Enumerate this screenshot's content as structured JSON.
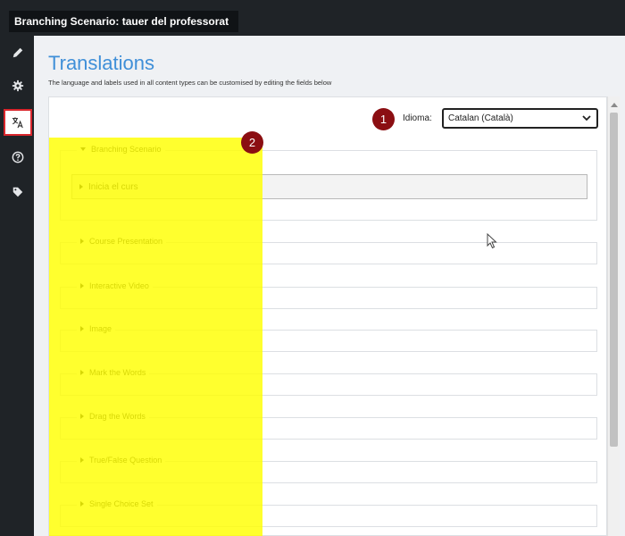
{
  "window": {
    "title": "Branching Scenario: tauer del professorat"
  },
  "sidebar": {
    "items": [
      {
        "icon": "pencil-icon",
        "active": false
      },
      {
        "icon": "gear-icon",
        "active": false
      },
      {
        "icon": "translate-icon",
        "active": true
      },
      {
        "icon": "help-icon",
        "active": false
      },
      {
        "icon": "tag-icon",
        "active": false
      }
    ]
  },
  "page": {
    "title": "Translations",
    "description": "The language and labels used in all content types can be customised by editing the fields below"
  },
  "language": {
    "label": "Idioma:",
    "selected": "Catalan (Català)"
  },
  "annotations": [
    "1",
    "2"
  ],
  "groups": [
    {
      "label": "Branching Scenario",
      "expanded": true,
      "subgroup": "Inicia el curs"
    },
    {
      "label": "Course Presentation",
      "expanded": false
    },
    {
      "label": "Interactive Video",
      "expanded": false
    },
    {
      "label": "Image",
      "expanded": false
    },
    {
      "label": "Mark the Words",
      "expanded": false
    },
    {
      "label": "Drag the Words",
      "expanded": false
    },
    {
      "label": "True/False Question",
      "expanded": false
    },
    {
      "label": "Single Choice Set",
      "expanded": false
    }
  ],
  "colors": {
    "accent": "#3f8fd8",
    "active_border": "#d9262c",
    "marker": "#8b0e12",
    "highlight": "#ffff00",
    "sidebar": "#1f2327"
  }
}
